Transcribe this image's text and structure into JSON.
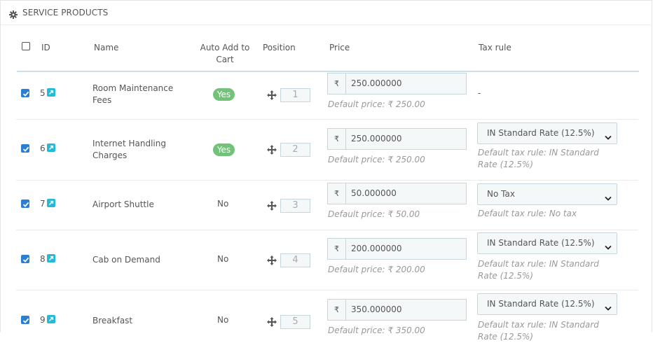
{
  "panel": {
    "title": "SERVICE PRODUCTS",
    "icon": "gear-icon"
  },
  "columns": {
    "id": "ID",
    "name": "Name",
    "auto_add": "Auto Add to Cart",
    "position": "Position",
    "price": "Price",
    "tax_rule": "Tax rule"
  },
  "select_all_checked": false,
  "rows": [
    {
      "checked": true,
      "id": "5",
      "name": "Room Maintenance Fees",
      "auto_add": "Yes",
      "position": "1",
      "currency": "₹",
      "price": "250.000000",
      "default_price": "Default price: ₹ 250.00",
      "tax_rule": "-",
      "default_tax": ""
    },
    {
      "checked": true,
      "id": "6",
      "name": "Internet Handling Charges",
      "auto_add": "Yes",
      "position": "2",
      "currency": "₹",
      "price": "250.000000",
      "default_price": "Default price: ₹ 250.00",
      "tax_rule": "IN Standard Rate (12.5%)",
      "default_tax": "Default tax rule: IN Standard Rate (12.5%)"
    },
    {
      "checked": true,
      "id": "7",
      "name": "Airport Shuttle",
      "auto_add": "No",
      "position": "3",
      "currency": "₹",
      "price": "50.000000",
      "default_price": "Default price: ₹ 50.00",
      "tax_rule": "No Tax",
      "default_tax": "Default tax rule: No tax"
    },
    {
      "checked": true,
      "id": "8",
      "name": "Cab on Demand",
      "auto_add": "No",
      "position": "4",
      "currency": "₹",
      "price": "200.000000",
      "default_price": "Default price: ₹ 200.00",
      "tax_rule": "IN Standard Rate (12.5%)",
      "default_tax": "Default tax rule: IN Standard Rate (12.5%)"
    },
    {
      "checked": true,
      "id": "9",
      "name": "Breakfast",
      "auto_add": "No",
      "position": "5",
      "currency": "₹",
      "price": "350.000000",
      "default_price": "Default price: ₹ 350.00",
      "tax_rule": "IN Standard Rate (12.5%)",
      "default_tax": "Default tax rule: IN Standard Rate (12.5%)"
    }
  ],
  "colors": {
    "accent": "#25b9d7",
    "checkbox": "#2a7fd4",
    "yes_badge": "#72c279",
    "header_border": "#c8e0ec"
  }
}
